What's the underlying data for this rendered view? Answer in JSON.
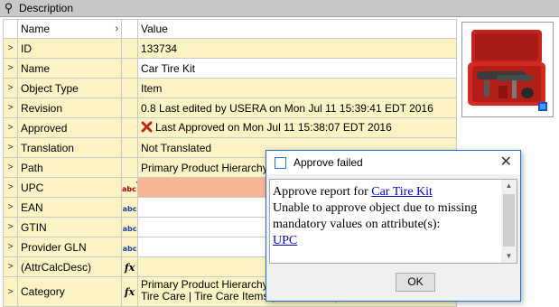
{
  "panel": {
    "title": "Description"
  },
  "grid": {
    "headers": {
      "name": "Name",
      "value": "Value"
    },
    "rows": [
      {
        "label": "ID",
        "value": "133734"
      },
      {
        "label": "Name",
        "value": "Car Tire Kit"
      },
      {
        "label": "Object Type",
        "value": "Item"
      },
      {
        "label": "Revision",
        "value": "0.8 Last edited by USERA on Mon Jul 11 15:39:41 EDT 2016"
      },
      {
        "label": "Approved",
        "value": "Last Approved on Mon Jul 11 15:38:07 EDT 2016"
      },
      {
        "label": "Translation",
        "value": "Not Translated"
      },
      {
        "label": "Path",
        "value": "Primary Product Hierarchy/Product"
      },
      {
        "label": "UPC",
        "value": ""
      },
      {
        "label": "EAN",
        "value": ""
      },
      {
        "label": "GTIN",
        "value": ""
      },
      {
        "label": "Provider GLN",
        "value": ""
      },
      {
        "label": "(AttrCalcDesc)",
        "value": ""
      },
      {
        "label": "Category",
        "value_line1": "Primary Product Hierarchy | Product",
        "value_line2": "Tire Care | Tire Care Items | Car Tire Kit | Car Tire Kit"
      }
    ],
    "type_badge": "abc",
    "calc_badge": "fx"
  },
  "dialog": {
    "title": "Approve failed",
    "message_prefix": "Approve report for",
    "object_link": "Car Tire Kit",
    "message_body": "Unable to approve object due to missing mandatory values on attribute(s):",
    "attribute_link": "UPC",
    "ok_label": "OK",
    "close_glyph": "✕"
  },
  "colors": {
    "row_bg": "#fbf3c4",
    "error_bg": "#fab597",
    "link": "#0000cc",
    "dialog_border": "#1b74c8"
  }
}
